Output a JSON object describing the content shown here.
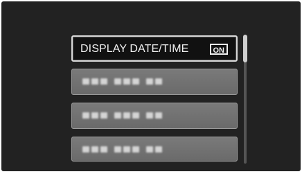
{
  "menu": {
    "items": [
      {
        "label": "DISPLAY DATE/TIME",
        "value": "ON",
        "selected": true
      },
      {
        "label": "",
        "value": "",
        "selected": false
      },
      {
        "label": "",
        "value": "",
        "selected": false
      },
      {
        "label": "",
        "value": "",
        "selected": false
      }
    ]
  },
  "scrollbar": {
    "position_fraction": 0.0
  },
  "colors": {
    "screen_background": "#222222",
    "item_background": "#6f6f6f",
    "selected_border": "#d8d8d8",
    "text": "#f2f2f2"
  }
}
